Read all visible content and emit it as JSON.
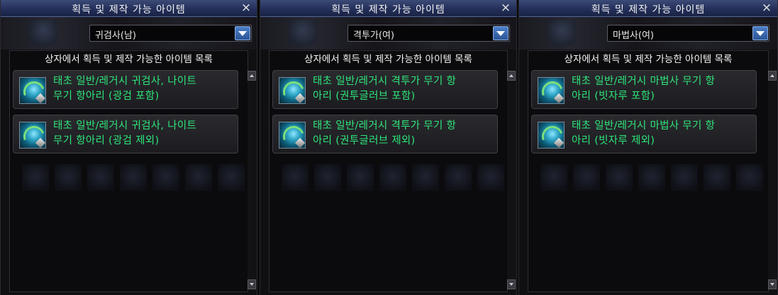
{
  "panels": [
    {
      "title": "획득 및 제작 가능 아이템",
      "close_icon": "×",
      "select_value": "귀검사(남)",
      "list_label": "상자에서 획득 및 제작 가능한 아이템 목록",
      "items": [
        {
          "line1": "태초 일반/레거시 귀검사, 나이트",
          "line2": "무기 항아리 (광검 포함)"
        },
        {
          "line1": "태초 일반/레거시 귀검사, 나이트",
          "line2": "무기 항아리 (광검 제외)"
        }
      ]
    },
    {
      "title": "획득 및 제작 가능 아이템",
      "close_icon": "×",
      "select_value": "격투가(여)",
      "list_label": "상자에서 획득 및 제작 가능한 아이템 목록",
      "items": [
        {
          "line1": "태초 일반/레거시 격투가 무기 항",
          "line2": "아리 (권투글러브 포함)"
        },
        {
          "line1": "태초 일반/레거시 격투가 무기 항",
          "line2": "아리 (권투글러브 제외)"
        }
      ]
    },
    {
      "title": "획득 및 제작 가능 아이템",
      "close_icon": "×",
      "select_value": "마법사(여)",
      "list_label": "상자에서 획득 및 제작 가능한 아이템 목록",
      "items": [
        {
          "line1": "태초 일반/레거시 마법사 무기 항",
          "line2": "아리 (빗자루 포함)"
        },
        {
          "line1": "태초 일반/레거시 마법사 무기 항",
          "line2": "아리 (빗자루 제외)"
        }
      ]
    }
  ],
  "icons": {
    "close": "close-icon",
    "dropdown": "chevron-down-icon",
    "item": "weapon-jar-icon",
    "scroll_up": "arrow-up-icon",
    "scroll_down": "arrow-down-icon"
  },
  "colors": {
    "titlebar": "#24305a",
    "item_text": "#2ee57a",
    "select_arrow": "#2c5596"
  }
}
